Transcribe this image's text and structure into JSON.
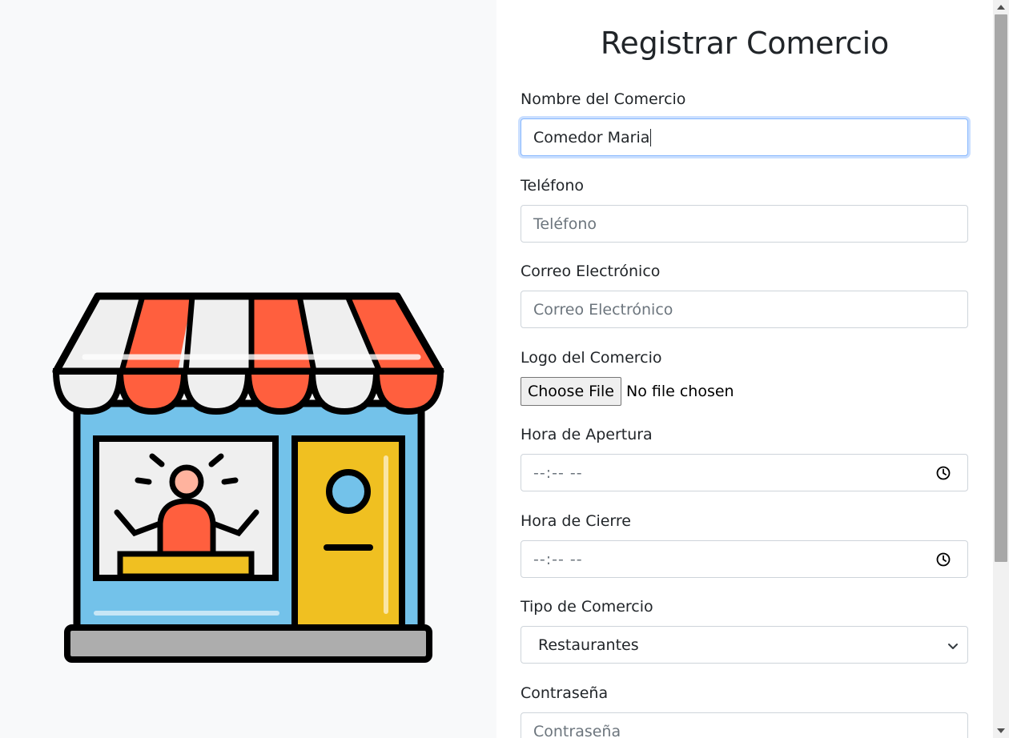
{
  "form": {
    "title": "Registrar Comercio",
    "name": {
      "label": "Nombre del Comercio",
      "value": "Comedor Maria"
    },
    "phone": {
      "label": "Teléfono",
      "placeholder": "Teléfono"
    },
    "email": {
      "label": "Correo Electrónico",
      "placeholder": "Correo Electrónico"
    },
    "logo": {
      "label": "Logo del Comercio",
      "button_label": "Choose File",
      "status": "No file chosen"
    },
    "opening_time": {
      "label": "Hora de Apertura",
      "value": "--:-- --"
    },
    "closing_time": {
      "label": "Hora de Cierre",
      "value": "--:-- --"
    },
    "business_type": {
      "label": "Tipo de Comercio",
      "selected": "Restaurantes"
    },
    "password": {
      "label": "Contraseña",
      "placeholder": "Contraseña"
    }
  },
  "icons": {
    "illustration": "storefront-icon",
    "time_picker": "clock-icon",
    "select": "chevron-down-icon"
  },
  "colors": {
    "focus_border": "#86b7fe",
    "left_background": "#f8f9fa",
    "awning_red": "#ff5f3e",
    "wall_blue": "#73c2ea",
    "door_yellow": "#f0c021"
  }
}
